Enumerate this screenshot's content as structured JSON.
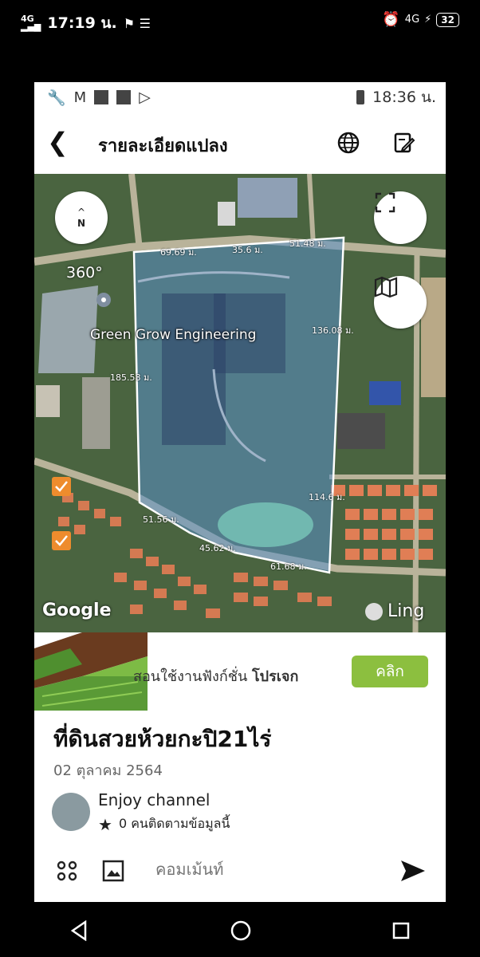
{
  "outer_status": {
    "network": "4G",
    "time": "17:19 น.",
    "net_right": "4G",
    "battery": "32"
  },
  "inner_status": {
    "time": "18:36 น."
  },
  "header": {
    "title": "รายละเอียดแปลง"
  },
  "map": {
    "compass": "N",
    "view_label": "360°",
    "place_name": "Green Grow Engineering",
    "measurements": [
      "69.69 ม.",
      "35.6 ม.",
      "51.48 ม.",
      "136.08 ม.",
      "185.58 ม.",
      "114.6 ม.",
      "51.56 ม.",
      "45.62 ม.",
      "61.68 ม."
    ],
    "provider": "Google",
    "watermark": "Ling"
  },
  "banner": {
    "text": "สอนใช้งานฟังก์ชั่น ",
    "bold": "โปรเจก",
    "button": "คลิก"
  },
  "post": {
    "title": "ที่ดินสวยห้วยกะปิ21ไร่",
    "date": "02 ตุลาคม 2564"
  },
  "author": {
    "name": "Enjoy channel",
    "followers": "0 คนติดตามข้อมูลนี้"
  },
  "comment": {
    "placeholder": "คอมเม้นท์"
  }
}
